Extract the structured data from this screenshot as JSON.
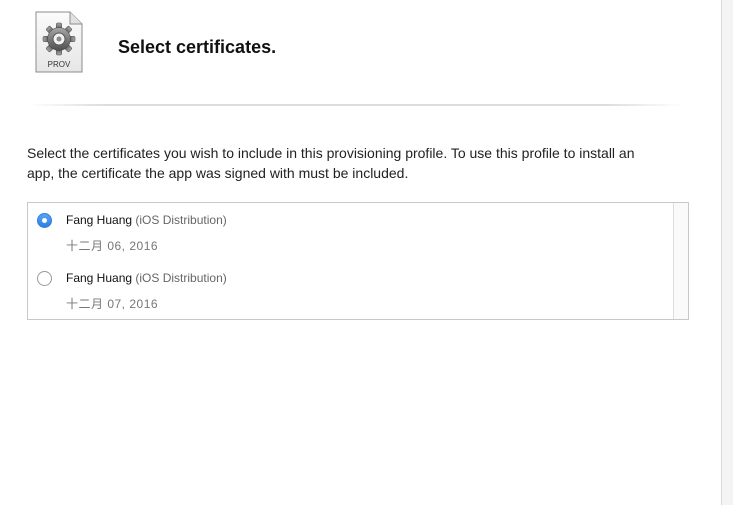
{
  "header": {
    "icon_label": "PROV",
    "icon_name": "provisioning-profile-icon",
    "title": "Select certificates."
  },
  "description": "Select the certificates you wish to include in this provisioning profile. To use this profile to install an app, the certificate the app was signed with must be included.",
  "certificates": [
    {
      "name": "Fang Huang",
      "type": "(iOS Distribution)",
      "date": "十二月 06, 2016",
      "selected": true
    },
    {
      "name": "Fang Huang",
      "type": "(iOS Distribution)",
      "date": "十二月 07, 2016",
      "selected": false
    }
  ],
  "colors": {
    "accent": "#2f7fe0",
    "border": "#c8c8c8",
    "text": "#222222",
    "muted": "#777777"
  }
}
